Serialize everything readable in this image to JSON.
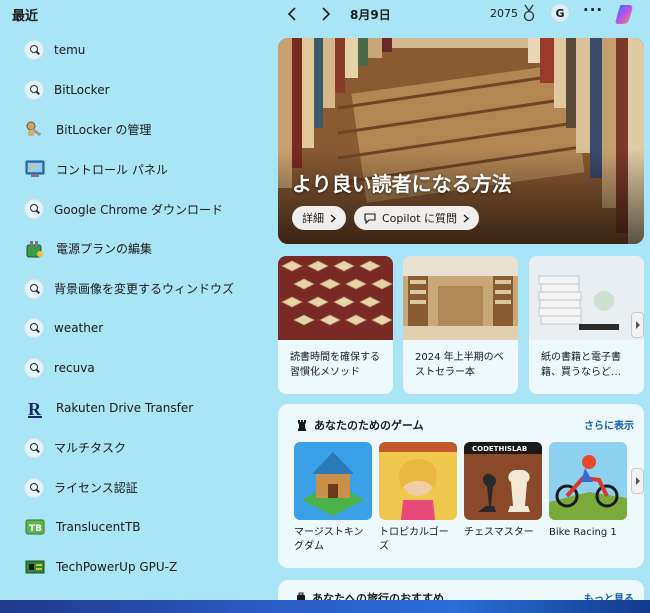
{
  "left": {
    "title": "最近",
    "items": [
      {
        "label": "temu",
        "icon": "search-icon"
      },
      {
        "label": "BitLocker",
        "icon": "search-icon"
      },
      {
        "label": "BitLocker の管理",
        "icon": "bitlocker-key-icon"
      },
      {
        "label": "コントロール パネル",
        "icon": "control-panel-icon"
      },
      {
        "label": "Google Chrome ダウンロード",
        "icon": "search-icon"
      },
      {
        "label": "電源プランの編集",
        "icon": "power-plan-icon"
      },
      {
        "label": "背景画像を変更するウィンドウズ",
        "icon": "search-icon"
      },
      {
        "label": "weather",
        "icon": "search-icon"
      },
      {
        "label": "recuva",
        "icon": "search-icon"
      },
      {
        "label": "Rakuten Drive Transfer",
        "icon": "rakuten-icon"
      },
      {
        "label": "マルチタスク",
        "icon": "search-icon"
      },
      {
        "label": "ライセンス認証",
        "icon": "search-icon"
      },
      {
        "label": "TranslucentTB",
        "icon": "translucenttb-icon"
      },
      {
        "label": "TechPowerUp GPU-Z",
        "icon": "gpu-z-icon"
      }
    ]
  },
  "topbar": {
    "date": "8月9日",
    "points": "2075",
    "avatar_letter": "G",
    "more": "···"
  },
  "hero": {
    "title": "より良い読者になる方法",
    "details_label": "詳細",
    "copilot_label": "Copilot に質問"
  },
  "cards": [
    {
      "text": "読書時間を確保する習慣化メソッド"
    },
    {
      "text": "2024 年上半期のベストセラー本"
    },
    {
      "text": "紙の書籍と電子書籍、買うならど…"
    }
  ],
  "games": {
    "title": "あなたのためのゲーム",
    "more": "さらに表示",
    "items": [
      {
        "title": "マージストキングダム"
      },
      {
        "title": "トロピカルゴーズ"
      },
      {
        "title": "チェスマスター"
      },
      {
        "title": "Bike Racing 1"
      }
    ],
    "chess_banner": "CODETHISLAB"
  },
  "travel": {
    "title": "あなたへの旅行のおすすめ",
    "more": "もっと見る"
  },
  "colors": {
    "background": "#a9e4f7",
    "card": "#eef9fe",
    "link": "#1a5fb4"
  }
}
